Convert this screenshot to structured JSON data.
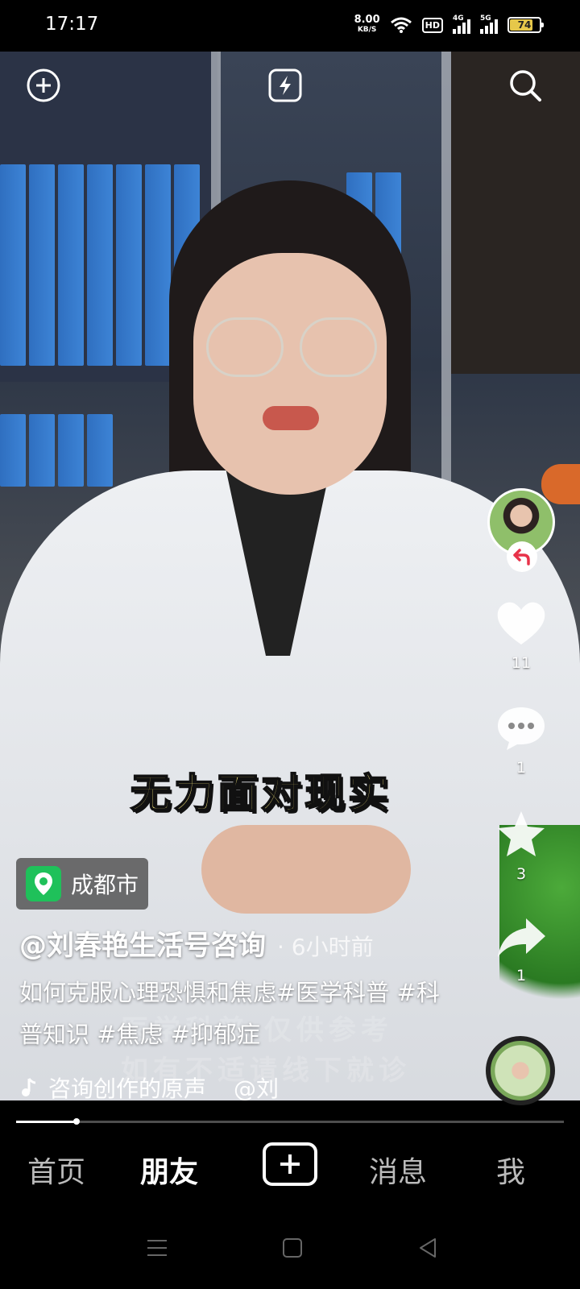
{
  "status": {
    "time": "17:17",
    "net_speed": "8.00",
    "net_unit": "KB/S",
    "hd": "HD",
    "sig1": "4G",
    "sig2": "5G",
    "battery": "74"
  },
  "top_bar": {
    "add_icon": "plus-circle-icon",
    "flash_icon": "lightning-icon",
    "search_icon": "search-icon"
  },
  "caption": "无力面对现实",
  "rail": {
    "likes": "11",
    "comments": "1",
    "favorites": "3",
    "shares": "1"
  },
  "location": "成都市",
  "author": "@刘春艳生活号咨询",
  "time_ago": "· 6小时前",
  "description": "如何克服心理恐惧和焦虑#医学科普 #科普知识 #焦虑 #抑郁症",
  "music": {
    "label": "咨询创作的原声",
    "extra": "@刘"
  },
  "video_overlay": [
    "医学科普  仅供参考",
    "如有不适请线下就诊"
  ],
  "progress_percent": 11,
  "nav": {
    "home": "首页",
    "friends": "朋友",
    "messages": "消息",
    "me": "我"
  }
}
